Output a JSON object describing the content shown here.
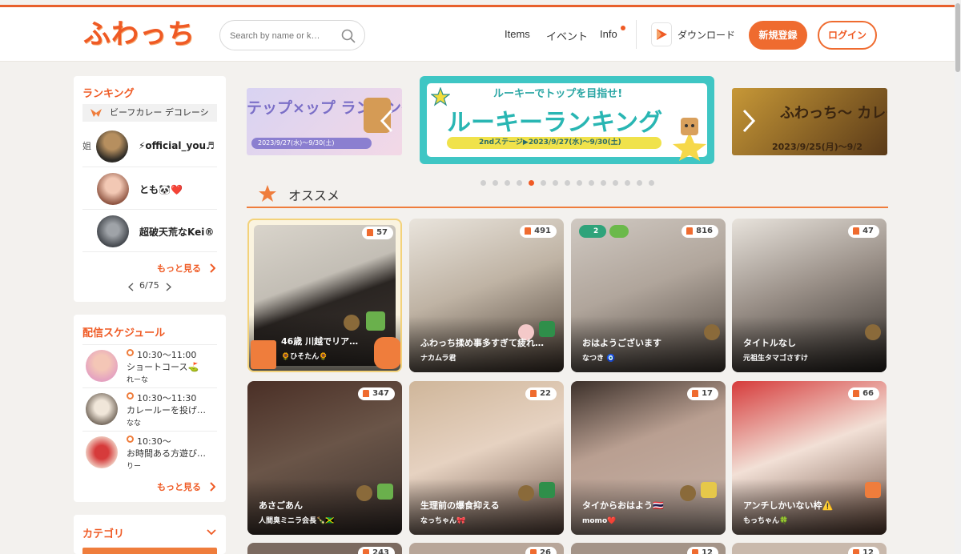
{
  "header": {
    "logo": "ふわっち",
    "search_placeholder": "Search by name or k…",
    "nav": {
      "items": "Items",
      "event": "イベント",
      "info": "Info",
      "download": "ダウンロード"
    },
    "signup": "新規登録",
    "login": "ログイン"
  },
  "ranking": {
    "title": "ランキング",
    "banner": "ビーフカレー デコレーシ",
    "rows": [
      {
        "rank": "姐",
        "name": "⚡official_you♬"
      },
      {
        "rank": "",
        "name": "とも🐼❤️"
      },
      {
        "rank": "",
        "name": "超破天荒なKei®"
      }
    ],
    "more": "もっと見る",
    "pager": "6/75"
  },
  "schedule": {
    "title": "配信スケジュール",
    "items": [
      {
        "time": "10:30〜11:00",
        "title": "ショートコース⛳",
        "host": "れーな"
      },
      {
        "time": "10:30〜11:30",
        "title": "カレールーを投げ…",
        "host": "なな"
      },
      {
        "time": "10:30〜",
        "title": "お時間ある方遊び…",
        "host": "りー"
      }
    ],
    "more": "もっと見る"
  },
  "category": {
    "title": "カテゴリ"
  },
  "banners": [
    {
      "label": "テップ×ップ ランキング",
      "sub": "2023/9/27(水)〜9/30(土)"
    },
    {
      "label": "ルーキーランキング",
      "top": "ルーキーでトップを目指せ!",
      "sub": "2ndステージ▶2023/9/27(水)〜9/30(土)"
    },
    {
      "label": "ふわっち〜 カレー天国",
      "sub": "2023/9/25(月)〜9/2"
    }
  ],
  "carousel": {
    "total_dots": 15,
    "active_index": 4
  },
  "section": {
    "title": "オススメ"
  },
  "cards": [
    {
      "title": "46歳 川越でリア…",
      "host": "🌻ひそたん🌻",
      "viewers": "57"
    },
    {
      "title": "ふわっち揉め事多すぎて疲れ…",
      "host": "ナカムラ君",
      "viewers": "491"
    },
    {
      "title": "おはようございます",
      "host": "なつき 🧿",
      "viewers": "816",
      "guests": "2"
    },
    {
      "title": "タイトルなし",
      "host": "元祖生タマゴさすけ",
      "viewers": "47"
    },
    {
      "title": "あさごあん",
      "host": "人間臭ミニラ会長🍾🇯🇲",
      "viewers": "347"
    },
    {
      "title": "生理前の爆食抑える",
      "host": "なっちゃん🎀",
      "viewers": "22"
    },
    {
      "title": "タイからおはよう🇹🇭",
      "host": "momo❤️",
      "viewers": "17"
    },
    {
      "title": "アンチしかいない枠⚠️",
      "host": "もっちゃん🍀",
      "viewers": "66"
    }
  ],
  "bottom_cards": [
    {
      "viewers": "243"
    },
    {
      "viewers": "26"
    },
    {
      "viewers": "12"
    },
    {
      "viewers": "12"
    }
  ]
}
